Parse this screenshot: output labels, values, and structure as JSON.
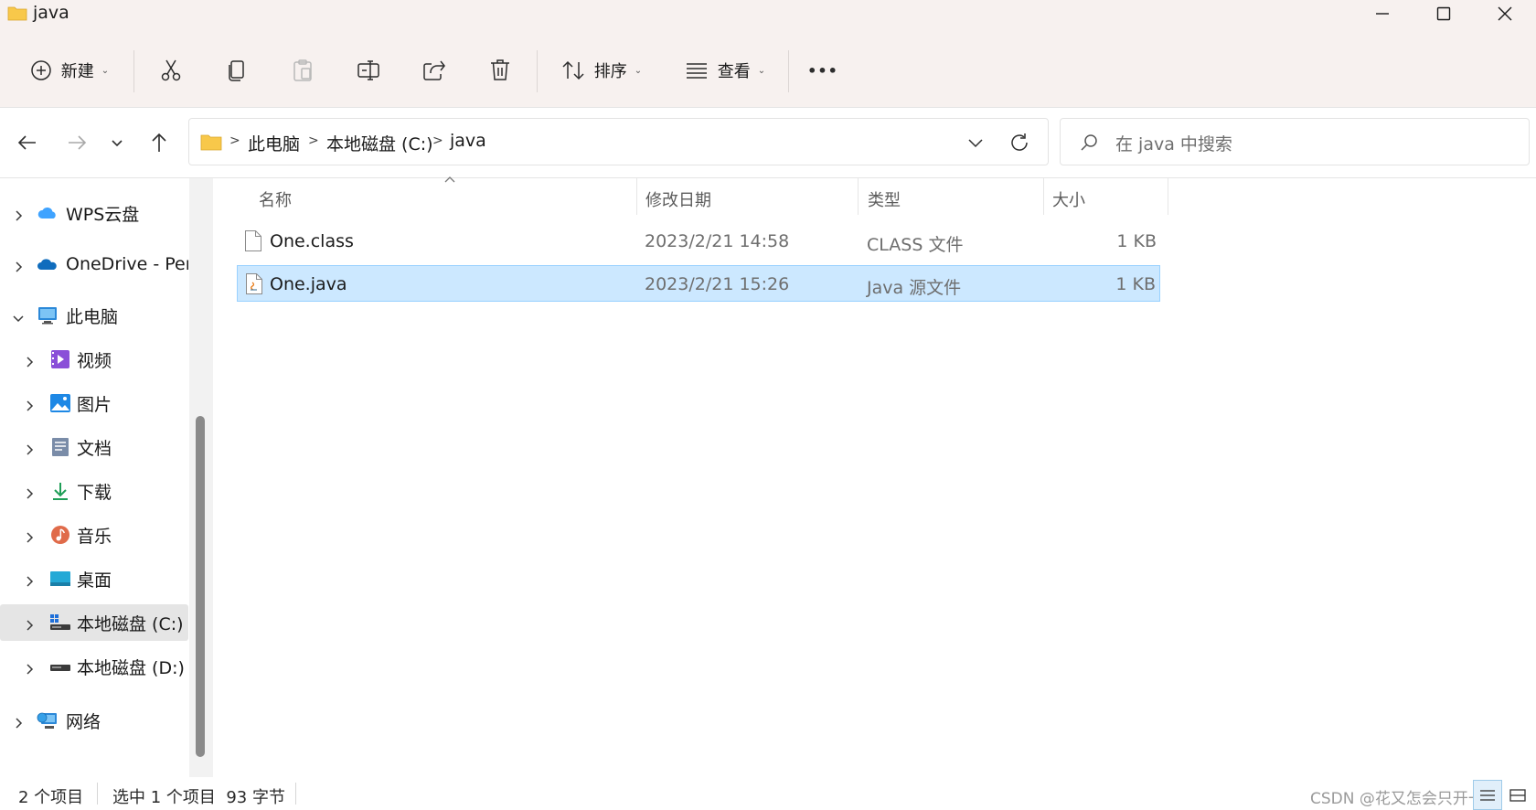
{
  "window": {
    "title": "java",
    "minimize_icon": "minimize-icon",
    "maximize_icon": "maximize-icon",
    "close_icon": "close-icon"
  },
  "toolbar": {
    "new_label": "新建",
    "sort_label": "排序",
    "view_label": "查看",
    "more_label": "•••",
    "icons": [
      "new-icon",
      "cut-icon",
      "copy-icon",
      "paste-icon",
      "rename-icon",
      "share-icon",
      "delete-icon",
      "sort-icon",
      "view-icon",
      "more-icon"
    ]
  },
  "address": {
    "crumbs": [
      "此电脑",
      "本地磁盘 (C:)",
      "java"
    ],
    "separator": ">",
    "search_placeholder": "在 java 中搜索"
  },
  "sidebar": {
    "items": [
      {
        "label": "WPS云盘",
        "icon": "cloud-icon"
      },
      {
        "label": "OneDrive - Pers",
        "icon": "onedrive-icon"
      },
      {
        "label": "此电脑",
        "icon": "computer-icon"
      },
      {
        "label": "视频",
        "icon": "video-icon"
      },
      {
        "label": "图片",
        "icon": "pictures-icon"
      },
      {
        "label": "文档",
        "icon": "documents-icon"
      },
      {
        "label": "下载",
        "icon": "download-icon"
      },
      {
        "label": "音乐",
        "icon": "music-icon"
      },
      {
        "label": "桌面",
        "icon": "desktop-icon"
      },
      {
        "label": "本地磁盘 (C:)",
        "icon": "drive-c-icon",
        "selected": true
      },
      {
        "label": "本地磁盘 (D:)",
        "icon": "drive-d-icon"
      },
      {
        "label": "网络",
        "icon": "network-icon"
      }
    ]
  },
  "filelist": {
    "columns": [
      "名称",
      "修改日期",
      "类型",
      "大小"
    ],
    "rows": [
      {
        "name": "One.class",
        "modified": "2023/2/21 14:58",
        "type": "CLASS 文件",
        "size": "1 KB"
      },
      {
        "name": "One.java",
        "modified": "2023/2/21 15:26",
        "type": "Java 源文件",
        "size": "1 KB",
        "selected": true
      }
    ]
  },
  "status": {
    "count": "2 个项目",
    "selection": "选中 1 个项目  93 字节",
    "watermark": "CSDN @花又怎会只开一季"
  },
  "colors": {
    "toolbar_bg": "#f7f1ef",
    "selection_bg": "#cce8ff",
    "selection_border": "#99d1ff",
    "folder_yellow": "#f8c84a"
  }
}
